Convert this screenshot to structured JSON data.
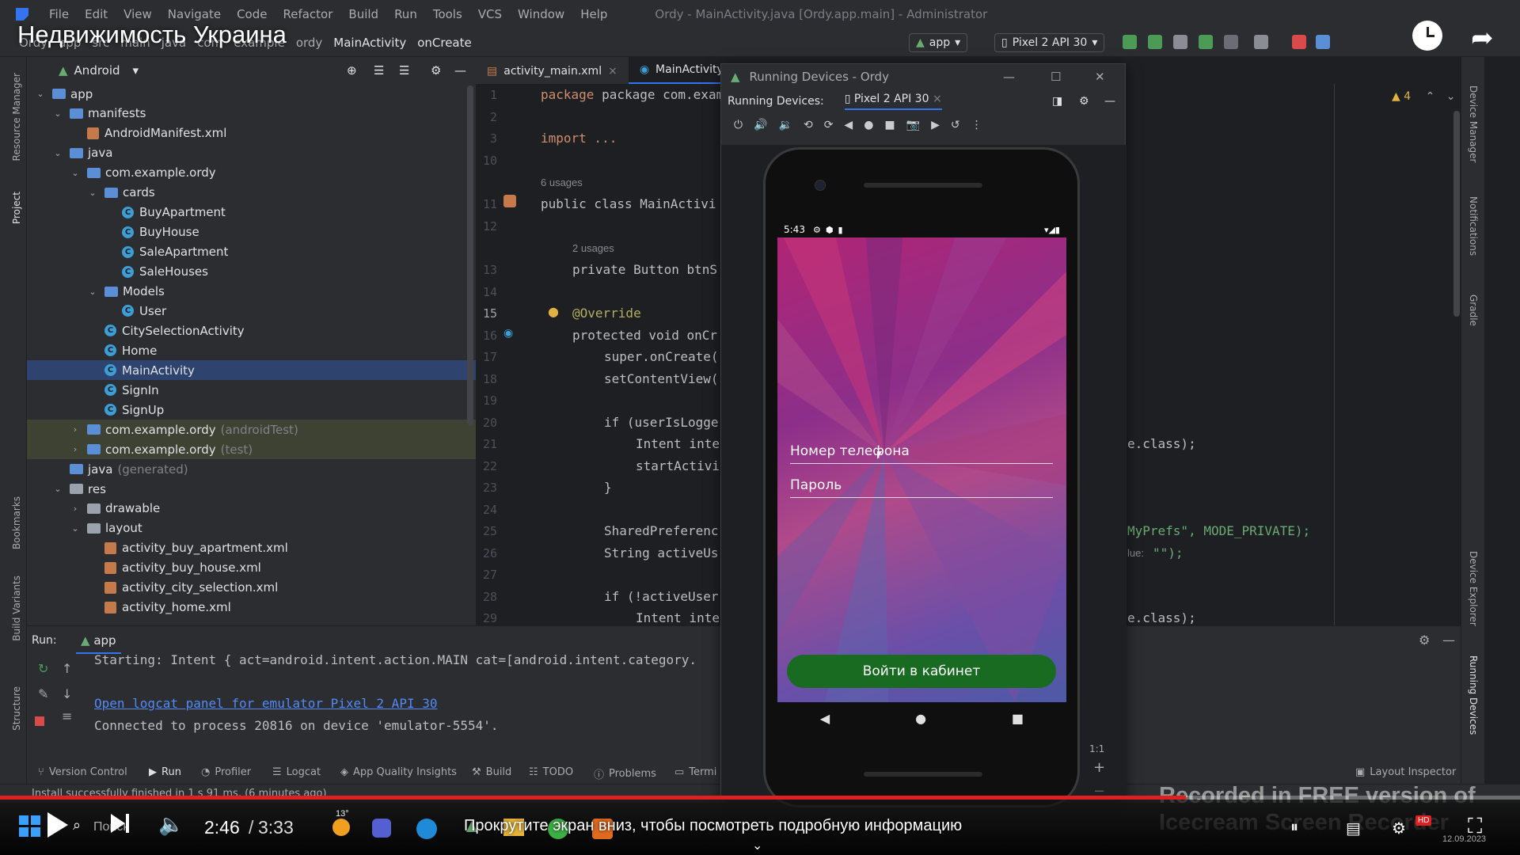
{
  "video": {
    "title": "Недвижимость Украина",
    "hint": "Прокрутите экран вниз, чтобы посмотреть подробную информацию",
    "time_current": "2:46",
    "time_separator": "/",
    "time_total": "3:33",
    "progress_percent": 78,
    "watermark": "Recorded in FREE version of Icecream Screen Recorder",
    "hd_badge": "HD",
    "taskbar_search": "Поиск",
    "taskbar_weather": "13°",
    "taskbar_date": "12.09.2023"
  },
  "menubar": {
    "items": [
      "File",
      "Edit",
      "View",
      "Navigate",
      "Code",
      "Refactor",
      "Build",
      "Run",
      "Tools",
      "VCS",
      "Window",
      "Help"
    ],
    "window_title": "Ordy - MainActivity.java [Ordy.app.main] - Administrator"
  },
  "toolbar": {
    "breadcrumb": [
      "Ordy",
      "app",
      "src",
      "main",
      "java",
      "com",
      "example",
      "ordy",
      "MainActivity",
      "onCreate"
    ],
    "run_config": "app",
    "device": "Pixel 2 API 30"
  },
  "project": {
    "view": "Android",
    "tree": [
      {
        "label": "app",
        "depth": 0,
        "kind": "folder",
        "chev": "v"
      },
      {
        "label": "manifests",
        "depth": 1,
        "kind": "folder",
        "chev": "v"
      },
      {
        "label": "AndroidManifest.xml",
        "depth": 2,
        "kind": "xml",
        "chev": ""
      },
      {
        "label": "java",
        "depth": 1,
        "kind": "folder",
        "chev": "v"
      },
      {
        "label": "com.example.ordy",
        "depth": 2,
        "kind": "folder",
        "chev": "v"
      },
      {
        "label": "cards",
        "depth": 3,
        "kind": "folder",
        "chev": "v"
      },
      {
        "label": "BuyApartment",
        "depth": 4,
        "kind": "class",
        "chev": ""
      },
      {
        "label": "BuyHouse",
        "depth": 4,
        "kind": "class",
        "chev": ""
      },
      {
        "label": "SaleApartment",
        "depth": 4,
        "kind": "class",
        "chev": ""
      },
      {
        "label": "SaleHouses",
        "depth": 4,
        "kind": "class",
        "chev": ""
      },
      {
        "label": "Models",
        "depth": 3,
        "kind": "folder",
        "chev": "v"
      },
      {
        "label": "User",
        "depth": 4,
        "kind": "class",
        "chev": ""
      },
      {
        "label": "CitySelectionActivity",
        "depth": 3,
        "kind": "class",
        "chev": ""
      },
      {
        "label": "Home",
        "depth": 3,
        "kind": "class",
        "chev": ""
      },
      {
        "label": "MainActivity",
        "depth": 3,
        "kind": "class",
        "chev": "",
        "selected": true
      },
      {
        "label": "SignIn",
        "depth": 3,
        "kind": "class",
        "chev": ""
      },
      {
        "label": "SignUp",
        "depth": 3,
        "kind": "class",
        "chev": ""
      },
      {
        "label": "com.example.ordy",
        "suffix": "(androidTest)",
        "depth": 2,
        "kind": "folder",
        "chev": ">",
        "hl": true
      },
      {
        "label": "com.example.ordy",
        "suffix": "(test)",
        "depth": 2,
        "kind": "folder",
        "chev": ">",
        "hl": true
      },
      {
        "label": "java",
        "suffix": "(generated)",
        "depth": 1,
        "kind": "folder",
        "chev": ""
      },
      {
        "label": "res",
        "depth": 1,
        "kind": "folder",
        "chev": "v"
      },
      {
        "label": "drawable",
        "depth": 2,
        "kind": "folder",
        "chev": ">"
      },
      {
        "label": "layout",
        "depth": 2,
        "kind": "folder",
        "chev": "v"
      },
      {
        "label": "activity_buy_apartment.xml",
        "depth": 3,
        "kind": "xml",
        "chev": ""
      },
      {
        "label": "activity_buy_house.xml",
        "depth": 3,
        "kind": "xml",
        "chev": ""
      },
      {
        "label": "activity_city_selection.xml",
        "depth": 3,
        "kind": "xml",
        "chev": ""
      },
      {
        "label": "activity_home.xml",
        "depth": 3,
        "kind": "xml",
        "chev": ""
      }
    ]
  },
  "editor": {
    "tabs": [
      "activity_main.xml",
      "MainActivity.ja"
    ],
    "warning_count": "4",
    "line_numbers": [
      "1",
      "2",
      "3",
      "10",
      "11",
      "12",
      "13",
      "14",
      "15",
      "16",
      "17",
      "18",
      "19",
      "20",
      "21",
      "22",
      "23",
      "24",
      "25",
      "26",
      "27",
      "28",
      "29"
    ],
    "current_line": "15",
    "usage_hints": [
      "6 usages",
      "2 usages"
    ],
    "code": {
      "l1": "package com.example.ord",
      "l3": "import ...",
      "l11": "public class MainActivi",
      "l13": "private Button btnS",
      "l15": "@Override",
      "l16": "protected void onCr",
      "l17": "super.onCreate(",
      "l18": "setContentView(",
      "l20": "if (userIsLogge",
      "l21": "Intent inte",
      "l22": "startActivi",
      "l23": "}",
      "l25": "SharedPreferenc",
      "l26": "String activeUs",
      "l28": "if (!activeUser",
      "l29": "Intent inte",
      "r21": "e.class);",
      "r25": "MyPrefs\", MODE_PRIVATE);",
      "r26_hint": "lue:",
      "r26": "\"\");",
      "r29": "e.class);"
    }
  },
  "running_devices": {
    "window_title": "Running Devices - Ordy",
    "tab_label": "Running Devices:",
    "device_tab": "Pixel 2 API 30",
    "zoom_label": "1:1"
  },
  "phone": {
    "time": "5:43",
    "phone_field": "Номер телефона",
    "password_field": "Пароль",
    "login_button": "Войти в кабинет"
  },
  "run": {
    "label": "Run:",
    "config": "app",
    "lines": [
      "Starting: Intent { act=android.intent.action.MAIN cat=[android.intent.category.",
      "Open logcat panel for emulator Pixel 2 API 30",
      "Connected to process 20816 on device 'emulator-5554'."
    ]
  },
  "bottom_tabs": [
    "Version Control",
    "Run",
    "Profiler",
    "Logcat",
    "App Quality Insights",
    "Build",
    "TODO",
    "Problems",
    "Termi",
    "Layout Inspector"
  ],
  "status": {
    "message": "Install successfully finished in 1 s 91 ms. (6 minutes ago)"
  },
  "side_labels": {
    "left": [
      "Resource Manager",
      "Project",
      "Bookmarks",
      "Build Variants",
      "Structure"
    ],
    "right": [
      "Device Manager",
      "Notifications",
      "Gradle",
      "Device Explorer",
      "Running Devices"
    ]
  },
  "colors": {
    "accent": "#3574f0",
    "selection": "#2e436e",
    "login_button": "#1a6b22",
    "progress": "#e02020"
  }
}
